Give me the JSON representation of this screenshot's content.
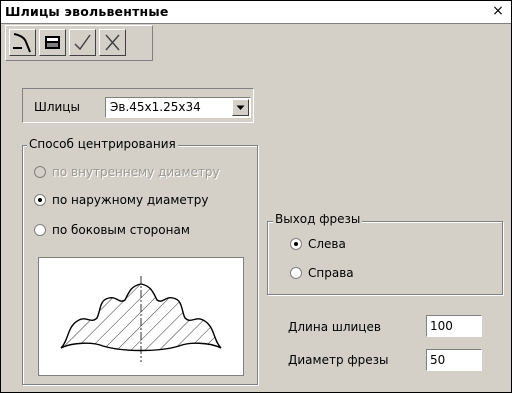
{
  "window": {
    "title": "Шлицы эвольвентные",
    "close_glyph": "×"
  },
  "toolbar": {
    "buttons": [
      {
        "icon": "mill-cutter-icon"
      },
      {
        "icon": "calculator-icon"
      },
      {
        "icon": "checkmark-icon"
      },
      {
        "icon": "cross-icon"
      }
    ]
  },
  "splines": {
    "label": "Шлицы",
    "selected": "Эв.45х1.25х34"
  },
  "centering": {
    "legend": "Способ центрирования",
    "options": [
      {
        "label": "по внутреннему диаметру",
        "checked": false,
        "disabled": true
      },
      {
        "label": "по наружному диаметру",
        "checked": true,
        "disabled": false
      },
      {
        "label": "по боковым сторонам",
        "checked": false,
        "disabled": false
      }
    ]
  },
  "cutter_exit": {
    "legend": "Выход фрезы",
    "options": [
      {
        "label": "Слева",
        "checked": true
      },
      {
        "label": "Справа",
        "checked": false
      }
    ]
  },
  "fields": {
    "length_label": "Длина шлицев",
    "length_value": "100",
    "diameter_label": "Диаметр фрезы",
    "diameter_value": "50"
  },
  "colors": {
    "window_bg": "#d4d0c8",
    "titlebar_bg": "#ffffff"
  }
}
